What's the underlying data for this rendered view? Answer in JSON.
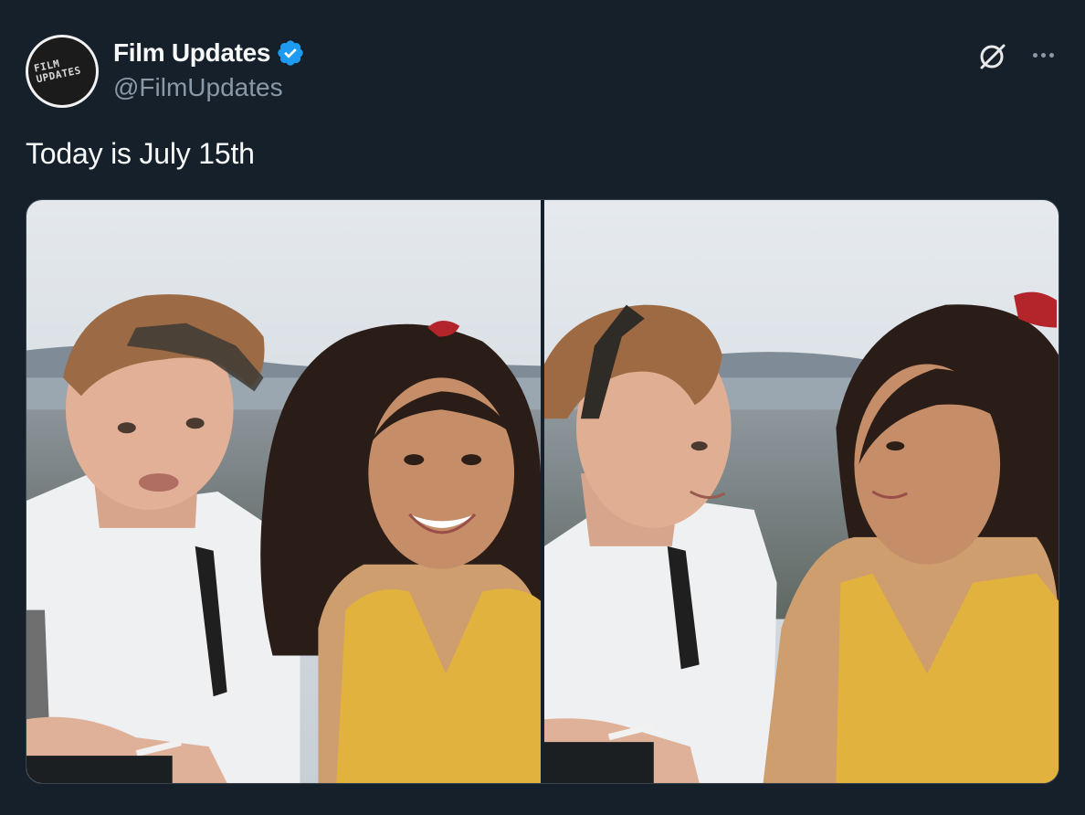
{
  "author": {
    "display_name": "Film Updates",
    "handle": "@FilmUpdates",
    "verified": true,
    "avatar_icon": "film-updates-logo",
    "avatar_text": "FILM UPDATES"
  },
  "header_actions": {
    "grok_icon": "grok-slash-icon",
    "more_icon": "more-horizontal-icon"
  },
  "tweet": {
    "text": "Today is July 15th"
  },
  "media": {
    "photos": [
      {
        "id": "photo-1",
        "description": "man-and-woman-smiling-at-camera"
      },
      {
        "id": "photo-2",
        "description": "man-and-woman-looking-at-each-other"
      }
    ]
  },
  "colors": {
    "background": "#15202b",
    "primary_text": "#f7f9f9",
    "secondary_text": "#8b98a5",
    "verified_badge": "#1d9bf0",
    "border": "#38444d"
  }
}
